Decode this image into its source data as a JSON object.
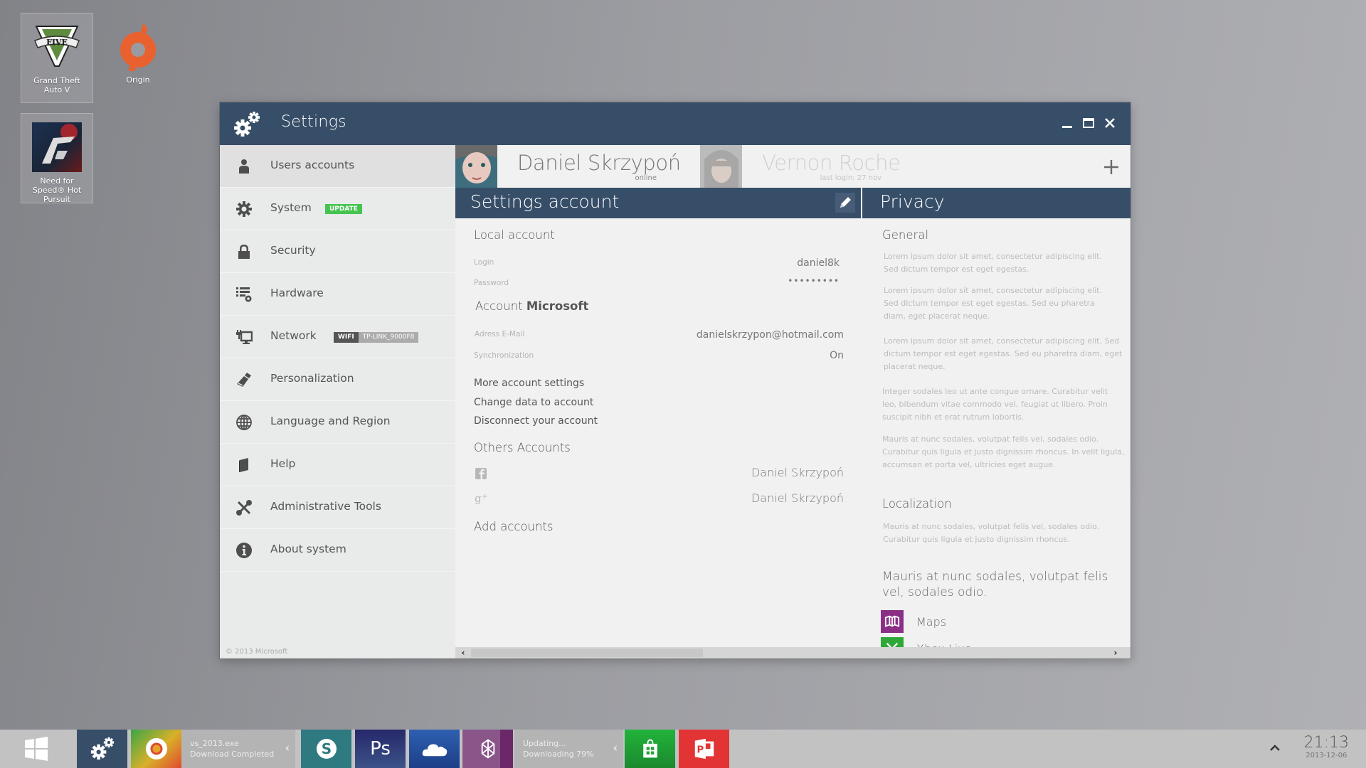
{
  "desktop": {
    "icons": [
      {
        "label": "Grand Theft Auto V",
        "icon": "gta-v-icon"
      },
      {
        "label": "Origin",
        "icon": "origin-icon"
      },
      {
        "label": "Need for Speed® Hot Pursuit",
        "icon": "nfs-icon"
      }
    ]
  },
  "window": {
    "title": "Settings",
    "controls": {
      "minimize": "minimize",
      "maximize": "maximize",
      "close": "close"
    }
  },
  "sidebar": {
    "items": [
      {
        "label": "Users accounts",
        "icon": "user-icon",
        "active": true
      },
      {
        "label": "System",
        "icon": "gear-icon",
        "badge": "UPDATE"
      },
      {
        "label": "Security",
        "icon": "lock-icon"
      },
      {
        "label": "Hardware",
        "icon": "hardware-icon"
      },
      {
        "label": "Network",
        "icon": "network-icon",
        "badge_type": "WIFI",
        "badge_value": "TP-LINK_9000F8"
      },
      {
        "label": "Personalization",
        "icon": "brush-icon"
      },
      {
        "label": "Language and Region",
        "icon": "globe-icon"
      },
      {
        "label": "Help",
        "icon": "book-icon"
      },
      {
        "label": "Administrative Tools",
        "icon": "tools-icon"
      },
      {
        "label": "About system",
        "icon": "info-icon"
      }
    ],
    "copyright": "© 2013 Microsoft"
  },
  "users": [
    {
      "name": "Daniel Skrzypoń",
      "status": "online"
    },
    {
      "name": "Vernon Roche",
      "status": "last login: 27 nov"
    }
  ],
  "account_panel": {
    "title": "Settings account",
    "local": {
      "title": "Local account",
      "login_label": "Login",
      "login_value": "daniel8k",
      "password_label": "Password",
      "password_value": "•••••••••"
    },
    "microsoft": {
      "title_prefix": "Account ",
      "title_bold": "Microsoft",
      "email_label": "Adress E-Mail",
      "email_value": "danielskrzypon@hotmail.com",
      "sync_label": "Synchronization",
      "sync_value": "On"
    },
    "links": [
      "More account settings",
      "Change data to account",
      "Disconnect your account"
    ],
    "others": {
      "title": "Others Accounts",
      "accounts": [
        {
          "service": "facebook",
          "name": "Daniel Skrzypoń"
        },
        {
          "service": "google-plus",
          "name": "Daniel Skrzypoń"
        }
      ],
      "add_label": "Add accounts"
    }
  },
  "privacy_panel": {
    "title": "Privacy",
    "general_title": "General",
    "paragraphs": [
      "Lorem ipsum dolor sit amet, consectetur adipiscing elit. Sed dictum tempor est eget egestas.",
      "Lorem ipsum dolor sit amet, consectetur adipiscing elit. Sed dictum tempor est eget egestas. Sed eu pharetra diam, eget placerat neque.",
      "Lorem ipsum dolor sit amet, consectetur adipiscing elit. Sed dictum tempor est eget egestas. Sed eu pharetra diam, eget placerat neque.",
      "Integer sodales leo ut ante congue ornare. Curabitur velit leo, bibendum vitae commodo vel, feugiat ut libero. Proin suscipit nibh et erat rutrum lobortis.",
      "Mauris at nunc sodales, volutpat felis vel, sodales odio. Curabitur quis ligula et justo dignissim rhoncus. In velit ligula, accumsan et porta vel, ultricies eget augue."
    ],
    "localization_title": "Localization",
    "localization_text": "Mauris at nunc sodales, volutpat felis vel, sodales odio. Curabitur quis ligula et justo dignissim rhoncus.",
    "apps_heading": "Mauris at nunc sodales, volutpat felis vel, sodales odio.",
    "apps": [
      {
        "name": "Maps",
        "color": "#8b2f86"
      },
      {
        "name": "Xbox Live",
        "color": "#30a838"
      }
    ]
  },
  "taskbar": {
    "start": "start-button",
    "apps": [
      {
        "name": "Settings",
        "color": "#374e68"
      },
      {
        "name": "Chrome",
        "color": "#d0a020"
      },
      {
        "name": "Skype",
        "color": "#2f7a80"
      },
      {
        "name": "Photoshop",
        "color": "#2b3a6e",
        "label": "Ps"
      },
      {
        "name": "SkyDrive",
        "color": "#2853a0"
      },
      {
        "name": "Zune",
        "color": "#7b4480"
      },
      {
        "name": "Store",
        "color": "#22a33a"
      },
      {
        "name": "PowerPoint",
        "color": "#e23434",
        "label": "P"
      }
    ],
    "downloads": [
      {
        "line1": "vs_2013.exe",
        "line2": "Download Completed"
      },
      {
        "line1": "Updating...",
        "line2": "Downloading 79%",
        "progress": 79
      }
    ],
    "clock": {
      "time": "21:13",
      "date": "2013-12-06"
    }
  },
  "colors": {
    "accent": "#374e68",
    "update_badge": "#45c450"
  }
}
